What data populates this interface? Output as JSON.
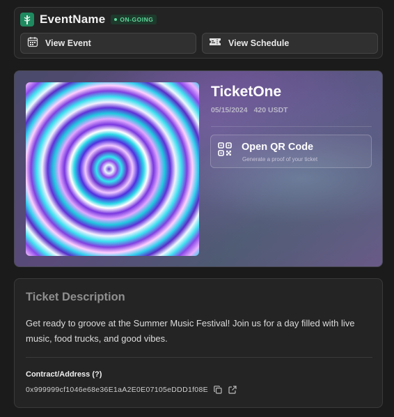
{
  "event": {
    "name": "EventName",
    "status": "ON-GOING",
    "logo_icon": "tree-logo-icon"
  },
  "nav": {
    "view_event_label": "View Event",
    "view_event_icon": "calendar-icon",
    "view_schedule_label": "View Schedule",
    "view_schedule_icon": "ticket-icon"
  },
  "ticket": {
    "title": "TicketOne",
    "date": "05/15/2024",
    "price": "420 USDT",
    "qr_button": {
      "title": "Open QR Code",
      "subtitle": "Generate a proof of your ticket",
      "icon": "qr-code-icon"
    }
  },
  "description": {
    "heading": "Ticket Description",
    "text": "Get ready to groove at the Summer Music Festival! Join us for a day filled with live music, food trucks, and good vibes.",
    "contract_label": "Contract/Address (?)",
    "contract_address": "0x999999cf1046e68e36E1aA2E0E07105eDDD1f08E",
    "copy_icon": "copy-icon",
    "external_icon": "external-link-icon"
  },
  "colors": {
    "background": "#1b1b1b",
    "card": "#232323",
    "status_green": "#5fd69a",
    "logo_green": "#1f8a60"
  }
}
